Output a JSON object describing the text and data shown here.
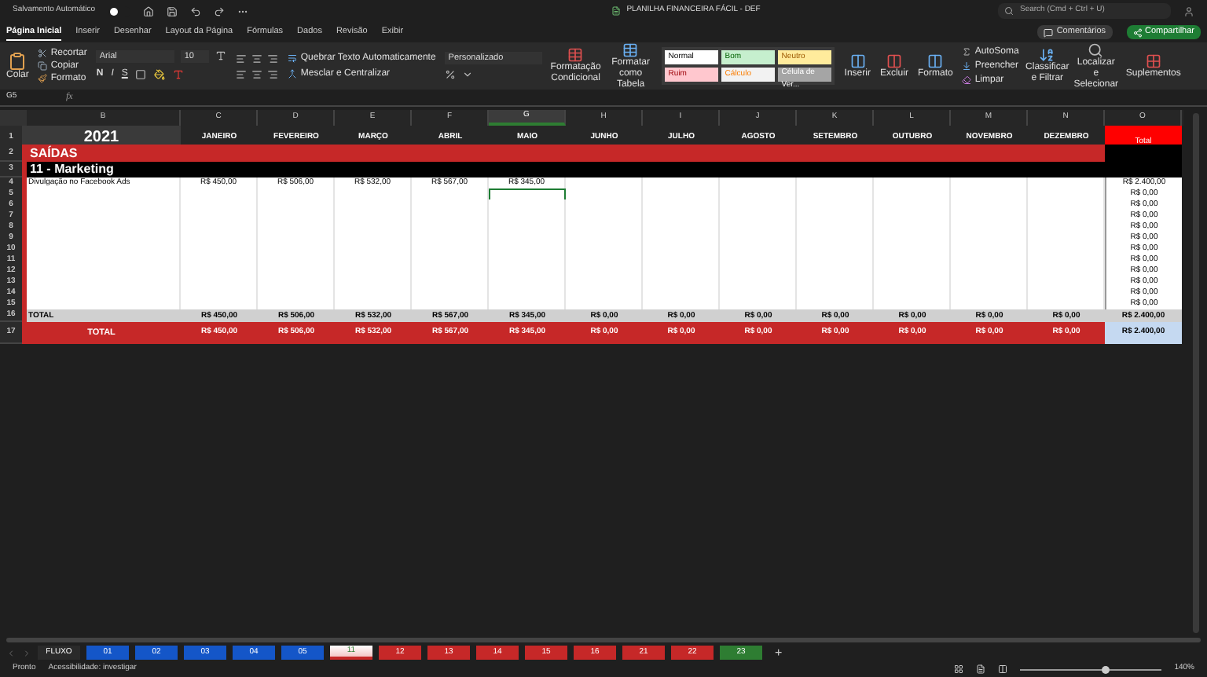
{
  "title_bar": {
    "autosave_label": "Salvamento Automático",
    "autosave_on": false,
    "title": "PLANILHA FINANCEIRA FÁCIL - DEF",
    "search_placeholder": "Search (Cmd + Ctrl + U)"
  },
  "menu_tabs": [
    {
      "label": "Página Inicial",
      "selected": true
    },
    {
      "label": "Inserir",
      "selected": false
    },
    {
      "label": "Desenhar",
      "selected": false
    },
    {
      "label": "Layout da Página",
      "selected": false
    },
    {
      "label": "Fórmulas",
      "selected": false
    },
    {
      "label": "Dados",
      "selected": false
    },
    {
      "label": "Revisão",
      "selected": false
    },
    {
      "label": "Exibir",
      "selected": false
    }
  ],
  "actions": {
    "comments": "Comentários",
    "share": "Compartilhar"
  },
  "ribbon": {
    "paste": "Colar",
    "cut": "Recortar",
    "copy": "Copiar",
    "format_painter": "Formato",
    "font": "Arial",
    "font_size": "10",
    "bold": "N",
    "italic": "I",
    "underline": "S",
    "wrap_text": "Quebrar Texto Automaticamente",
    "merge": "Mesclar e Centralizar",
    "number_format": "Personalizado",
    "conditional": "Formatação Condicional",
    "as_table": "Formatar como Tabela",
    "styles": [
      {
        "label": "Normal",
        "kind": "normal"
      },
      {
        "label": "Bom",
        "kind": "good"
      },
      {
        "label": "Neutro",
        "kind": "neutral"
      },
      {
        "label": "Ruim",
        "kind": "bad"
      },
      {
        "label": "Cálculo",
        "kind": "calc"
      },
      {
        "label": "Célula de Ver...",
        "kind": "check"
      }
    ],
    "insert": "Inserir",
    "delete": "Excluir",
    "format": "Formato",
    "autosum": "AutoSoma",
    "fill": "Preencher",
    "clear": "Limpar",
    "sort": "Classificar e Filtrar",
    "find": "Localizar e Selecionar",
    "addins": "Suplementos"
  },
  "formula_bar": {
    "name_box": "G5",
    "fx": "fx"
  },
  "columns": [
    {
      "letter": "B",
      "selected": false
    },
    {
      "letter": "C",
      "selected": false
    },
    {
      "letter": "D",
      "selected": false
    },
    {
      "letter": "E",
      "selected": false
    },
    {
      "letter": "F",
      "selected": false
    },
    {
      "letter": "G",
      "selected": true
    },
    {
      "letter": "H",
      "selected": false
    },
    {
      "letter": "I",
      "selected": false
    },
    {
      "letter": "J",
      "selected": false
    },
    {
      "letter": "K",
      "selected": false
    },
    {
      "letter": "L",
      "selected": false
    },
    {
      "letter": "M",
      "selected": false
    },
    {
      "letter": "N",
      "selected": false
    },
    {
      "letter": "O",
      "selected": false
    }
  ],
  "header_row": {
    "number": "1",
    "year": "2021",
    "months": [
      "JANEIRO",
      "FEVEREIRO",
      "MARÇO",
      "ABRIL",
      "MAIO",
      "JUNHO",
      "JULHO",
      "AGOSTO",
      "SETEMBRO",
      "OUTUBRO",
      "NOVEMBRO",
      "DEZEMBRO"
    ],
    "total": "Total"
  },
  "section_row": {
    "number": "2",
    "label": "SAÍDAS"
  },
  "category_row": {
    "number": "3",
    "label": "11 - Marketing"
  },
  "rows": [
    {
      "number": "4",
      "label": "Divulgação no Facebook Ads",
      "total": "R$ 2.400,00",
      "cells": [
        {
          "value": "R$ 450,00",
          "selected": false
        },
        {
          "value": "R$ 506,00",
          "selected": false
        },
        {
          "value": "R$ 532,00",
          "selected": false
        },
        {
          "value": "R$ 567,00",
          "selected": false
        },
        {
          "value": "R$ 345,00",
          "selected": false
        },
        {
          "selected": false
        },
        {
          "selected": false
        },
        {
          "selected": false
        },
        {
          "selected": false
        },
        {
          "selected": false
        },
        {
          "selected": false
        },
        {
          "selected": false
        }
      ]
    },
    {
      "number": "5",
      "total": "R$ 0,00",
      "cells": [
        {
          "selected": false
        },
        {
          "selected": false
        },
        {
          "selected": false
        },
        {
          "selected": false
        },
        {
          "selected": true
        },
        {
          "selected": false
        },
        {
          "selected": false
        },
        {
          "selected": false
        },
        {
          "selected": false
        },
        {
          "selected": false
        },
        {
          "selected": false
        },
        {
          "selected": false
        }
      ]
    },
    {
      "number": "6",
      "total": "R$ 0,00",
      "cells": [
        {
          "selected": false
        },
        {
          "selected": false
        },
        {
          "selected": false
        },
        {
          "selected": false
        },
        {
          "selected": false
        },
        {
          "selected": false
        },
        {
          "selected": false
        },
        {
          "selected": false
        },
        {
          "selected": false
        },
        {
          "selected": false
        },
        {
          "selected": false
        },
        {
          "selected": false
        }
      ]
    },
    {
      "number": "7",
      "total": "R$ 0,00",
      "cells": [
        {
          "selected": false
        },
        {
          "selected": false
        },
        {
          "selected": false
        },
        {
          "selected": false
        },
        {
          "selected": false
        },
        {
          "selected": false
        },
        {
          "selected": false
        },
        {
          "selected": false
        },
        {
          "selected": false
        },
        {
          "selected": false
        },
        {
          "selected": false
        },
        {
          "selected": false
        }
      ]
    },
    {
      "number": "8",
      "total": "R$ 0,00",
      "cells": [
        {
          "selected": false
        },
        {
          "selected": false
        },
        {
          "selected": false
        },
        {
          "selected": false
        },
        {
          "selected": false
        },
        {
          "selected": false
        },
        {
          "selected": false
        },
        {
          "selected": false
        },
        {
          "selected": false
        },
        {
          "selected": false
        },
        {
          "selected": false
        },
        {
          "selected": false
        }
      ]
    },
    {
      "number": "9",
      "total": "R$ 0,00",
      "cells": [
        {
          "selected": false
        },
        {
          "selected": false
        },
        {
          "selected": false
        },
        {
          "selected": false
        },
        {
          "selected": false
        },
        {
          "selected": false
        },
        {
          "selected": false
        },
        {
          "selected": false
        },
        {
          "selected": false
        },
        {
          "selected": false
        },
        {
          "selected": false
        },
        {
          "selected": false
        }
      ]
    },
    {
      "number": "10",
      "total": "R$ 0,00",
      "cells": [
        {
          "selected": false
        },
        {
          "selected": false
        },
        {
          "selected": false
        },
        {
          "selected": false
        },
        {
          "selected": false
        },
        {
          "selected": false
        },
        {
          "selected": false
        },
        {
          "selected": false
        },
        {
          "selected": false
        },
        {
          "selected": false
        },
        {
          "selected": false
        },
        {
          "selected": false
        }
      ]
    },
    {
      "number": "11",
      "total": "R$ 0,00",
      "cells": [
        {
          "selected": false
        },
        {
          "selected": false
        },
        {
          "selected": false
        },
        {
          "selected": false
        },
        {
          "selected": false
        },
        {
          "selected": false
        },
        {
          "selected": false
        },
        {
          "selected": false
        },
        {
          "selected": false
        },
        {
          "selected": false
        },
        {
          "selected": false
        },
        {
          "selected": false
        }
      ]
    },
    {
      "number": "12",
      "total": "R$ 0,00",
      "cells": [
        {
          "selected": false
        },
        {
          "selected": false
        },
        {
          "selected": false
        },
        {
          "selected": false
        },
        {
          "selected": false
        },
        {
          "selected": false
        },
        {
          "selected": false
        },
        {
          "selected": false
        },
        {
          "selected": false
        },
        {
          "selected": false
        },
        {
          "selected": false
        },
        {
          "selected": false
        }
      ]
    },
    {
      "number": "13",
      "total": "R$ 0,00",
      "cells": [
        {
          "selected": false
        },
        {
          "selected": false
        },
        {
          "selected": false
        },
        {
          "selected": false
        },
        {
          "selected": false
        },
        {
          "selected": false
        },
        {
          "selected": false
        },
        {
          "selected": false
        },
        {
          "selected": false
        },
        {
          "selected": false
        },
        {
          "selected": false
        },
        {
          "selected": false
        }
      ]
    },
    {
      "number": "14",
      "total": "R$ 0,00",
      "cells": [
        {
          "selected": false
        },
        {
          "selected": false
        },
        {
          "selected": false
        },
        {
          "selected": false
        },
        {
          "selected": false
        },
        {
          "selected": false
        },
        {
          "selected": false
        },
        {
          "selected": false
        },
        {
          "selected": false
        },
        {
          "selected": false
        },
        {
          "selected": false
        },
        {
          "selected": false
        }
      ]
    },
    {
      "number": "15",
      "total": "R$ 0,00",
      "cells": [
        {
          "selected": false
        },
        {
          "selected": false
        },
        {
          "selected": false
        },
        {
          "selected": false
        },
        {
          "selected": false
        },
        {
          "selected": false
        },
        {
          "selected": false
        },
        {
          "selected": false
        },
        {
          "selected": false
        },
        {
          "selected": false
        },
        {
          "selected": false
        },
        {
          "selected": false
        }
      ]
    }
  ],
  "subtotal_row": {
    "number": "16",
    "label": "TOTAL",
    "values": [
      "R$ 450,00",
      "R$ 506,00",
      "R$ 532,00",
      "R$ 567,00",
      "R$ 345,00",
      "R$ 0,00",
      "R$ 0,00",
      "R$ 0,00",
      "R$ 0,00",
      "R$ 0,00",
      "R$ 0,00",
      "R$ 0,00"
    ],
    "total": "R$ 2.400,00"
  },
  "total_row": {
    "number": "17",
    "label": "TOTAL",
    "values": [
      "R$ 450,00",
      "R$ 506,00",
      "R$ 532,00",
      "R$ 567,00",
      "R$ 345,00",
      "R$ 0,00",
      "R$ 0,00",
      "R$ 0,00",
      "R$ 0,00",
      "R$ 0,00",
      "R$ 0,00",
      "R$ 0,00"
    ],
    "total": "R$ 2.400,00"
  },
  "sheet_tabs": [
    {
      "label": "FLUXO",
      "color": "#2a2a2a",
      "selected": false
    },
    {
      "label": "01",
      "color": "#1456c8",
      "selected": false
    },
    {
      "label": "02",
      "color": "#1456c8",
      "selected": false
    },
    {
      "label": "03",
      "color": "#1456c8",
      "selected": false
    },
    {
      "label": "04",
      "color": "#1456c8",
      "selected": false
    },
    {
      "label": "05",
      "color": "#1456c8",
      "selected": false
    },
    {
      "label": "11",
      "color": "#c62828",
      "selected": true
    },
    {
      "label": "12",
      "color": "#c62828",
      "selected": false
    },
    {
      "label": "13",
      "color": "#c62828",
      "selected": false
    },
    {
      "label": "14",
      "color": "#c62828",
      "selected": false
    },
    {
      "label": "15",
      "color": "#c62828",
      "selected": false
    },
    {
      "label": "16",
      "color": "#c62828",
      "selected": false
    },
    {
      "label": "21",
      "color": "#c62828",
      "selected": false
    },
    {
      "label": "22",
      "color": "#c62828",
      "selected": false
    },
    {
      "label": "23",
      "color": "#2e7d32",
      "selected": false
    }
  ],
  "add_sheet": "+",
  "status_bar": {
    "ready": "Pronto",
    "accessibility": "Acessibilidade: investigar",
    "zoom": "140%",
    "zoom_slider": {
      "level": 0.6
    }
  }
}
